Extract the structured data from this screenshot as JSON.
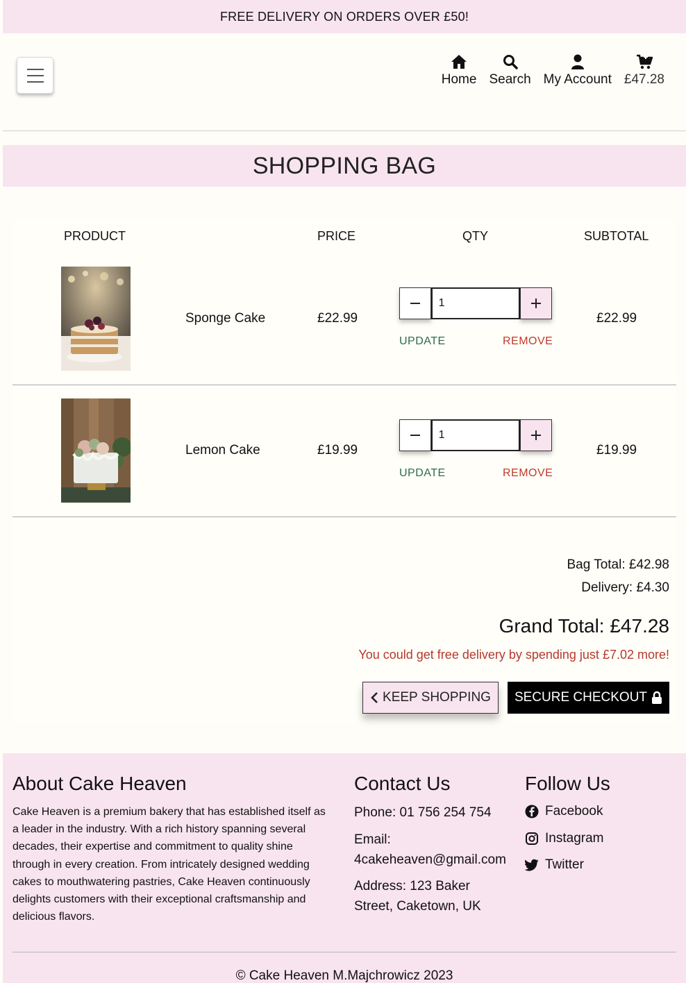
{
  "banner": {
    "text": "FREE DELIVERY ON ORDERS OVER £50!"
  },
  "nav": {
    "menu_icon": "hamburger-icon",
    "items": [
      {
        "label": "Home",
        "icon": "home-icon"
      },
      {
        "label": "Search",
        "icon": "search-icon"
      },
      {
        "label": "My Account",
        "icon": "user-icon"
      },
      {
        "label": "£47.28",
        "icon": "cart-icon"
      }
    ]
  },
  "page": {
    "title": "SHOPPING BAG"
  },
  "table": {
    "headers": [
      "PRODUCT",
      "PRICE",
      "QTY",
      "SUBTOTAL"
    ],
    "rows": [
      {
        "name": "Sponge Cake",
        "price": "£22.99",
        "qty": "1",
        "subtotal": "£22.99",
        "update": "UPDATE",
        "remove": "REMOVE"
      },
      {
        "name": "Lemon Cake",
        "price": "£19.99",
        "qty": "1",
        "subtotal": "£19.99",
        "update": "UPDATE",
        "remove": "REMOVE"
      }
    ]
  },
  "summary": {
    "bag_total": "Bag Total: £42.98",
    "delivery": "Delivery: £4.30",
    "grand_total": "Grand Total: £47.28",
    "free_delivery_msg": "You could get free delivery by spending just £7.02 more!",
    "keep_shopping": "KEEP SHOPPING",
    "secure_checkout": "SECURE CHECKOUT"
  },
  "footer": {
    "about_title": "About Cake Heaven",
    "about_lines": [
      "Cake Heaven is a premium bakery that has established itself as",
      "a leader in the industry. With a rich history spanning several",
      "decades, their expertise and commitment to quality shine",
      "through in every creation. From intricately designed wedding",
      "cakes to mouthwatering pastries, Cake Heaven continuously",
      "delights customers with their exceptional craftsmanship and",
      "delicious flavors."
    ],
    "contact_title": "Contact Us",
    "phone": "Phone: 01 756 254 754",
    "email_label": "Email:",
    "email": "4cakeheaven@gmail.com",
    "address_line1": "Address: 123 Baker",
    "address_line2": "Street, Caketown, UK",
    "follow_title": "Follow Us",
    "social": [
      {
        "label": "Facebook",
        "icon": "facebook-icon"
      },
      {
        "label": "Instagram",
        "icon": "instagram-icon"
      },
      {
        "label": "Twitter",
        "icon": "twitter-icon"
      }
    ],
    "copyright": "© Cake Heaven M.Majchrowicz 2023"
  },
  "colors": {
    "pink": "#f8e4ee",
    "update_green": "#2f6b45",
    "remove_red": "#c0392b",
    "checkout_black": "#000000"
  }
}
